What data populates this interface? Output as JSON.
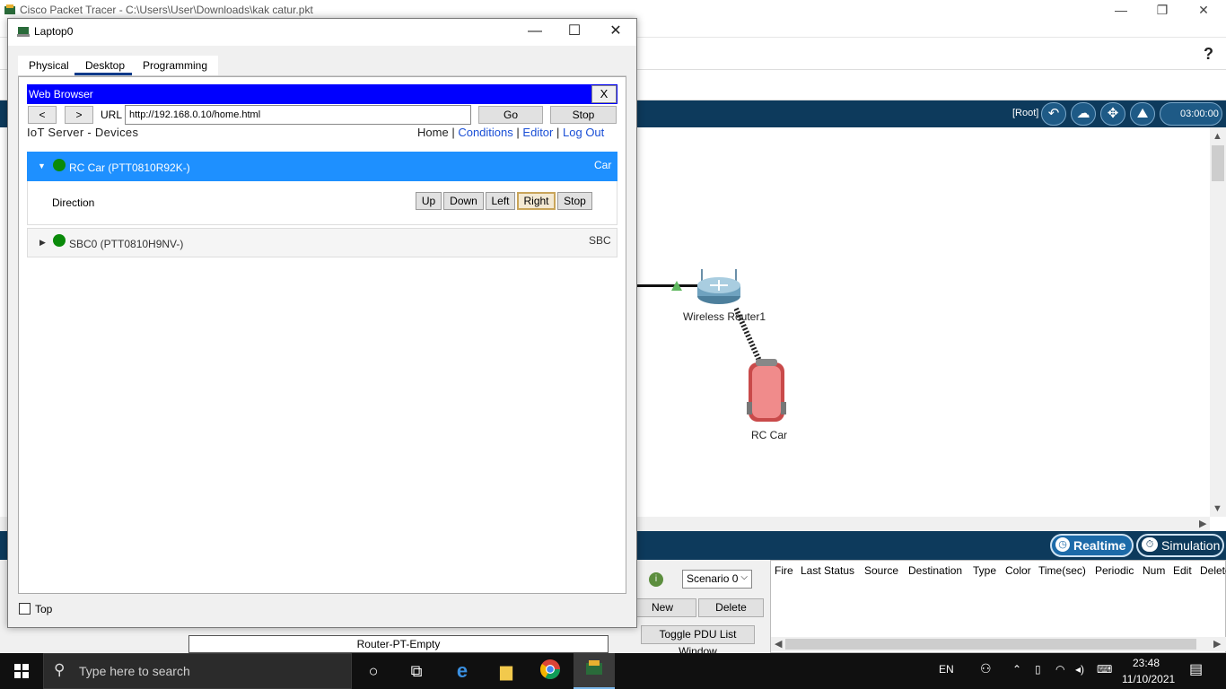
{
  "app": {
    "title": "Cisco Packet Tracer - C:\\Users\\User\\Downloads\\kak catur.pkt",
    "help_label": "?",
    "root_label": "[Root]",
    "clock": "03:00:00",
    "realtime_label": "Realtime",
    "simulation_label": "Simulation"
  },
  "topology": {
    "router_label": "Wireless Router1",
    "car_label": "RC Car"
  },
  "dialog": {
    "title": "Laptop0",
    "tabs": [
      {
        "label": "Physical"
      },
      {
        "label": "Desktop"
      },
      {
        "label": "Programming"
      }
    ],
    "top_label": "Top"
  },
  "browser": {
    "title": "Web Browser",
    "close_label": "X",
    "back_label": "<",
    "forward_label": ">",
    "url_label": "URL",
    "url_value": "http://192.168.0.10/home.html",
    "go_label": "Go",
    "stop_label": "Stop"
  },
  "iot": {
    "title": "IoT Server - Devices",
    "nav": {
      "home": "Home",
      "sep": "|",
      "conditions": "Conditions",
      "editor": "Editor",
      "logout": "Log Out"
    },
    "devices": [
      {
        "name": "RC Car (PTT0810R92K-)",
        "type": "Car",
        "control_label": "Direction",
        "buttons": [
          "Up",
          "Down",
          "Left",
          "Right",
          "Stop"
        ]
      },
      {
        "name": "SBC0 (PTT0810H9NV-)",
        "type": "SBC"
      }
    ]
  },
  "sim_panel": {
    "scenario": "Scenario 0",
    "new_label": "New",
    "delete_label": "Delete",
    "toggle_label": "Toggle PDU List Window",
    "columns": [
      "Fire",
      "Last Status",
      "Source",
      "Destination",
      "Type",
      "Color",
      "Time(sec)",
      "Periodic",
      "Num",
      "Edit",
      "Delete"
    ],
    "device_name": "Router-PT-Empty"
  },
  "taskbar": {
    "search_placeholder": "Type here to search",
    "language": "EN",
    "time": "23:48",
    "date": "11/10/2021"
  }
}
